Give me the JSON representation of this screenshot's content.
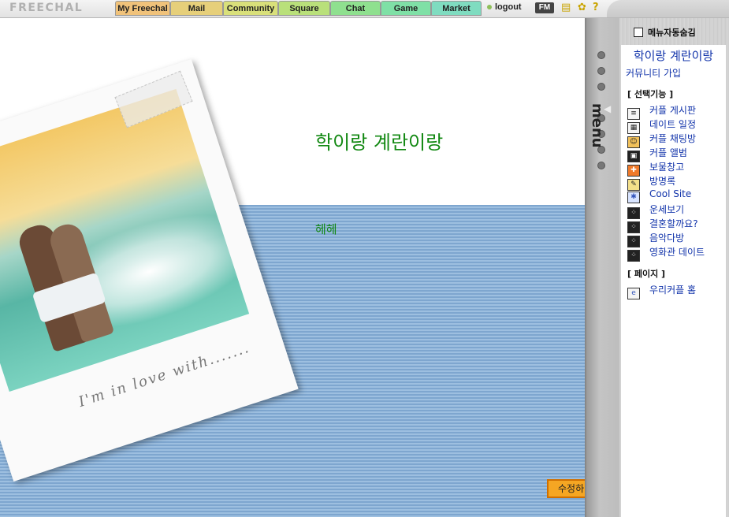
{
  "topbar": {
    "logo": "FREECHAL",
    "tabs": [
      {
        "label": "My Freechal",
        "color": "#f0c27a"
      },
      {
        "label": "Mail",
        "color": "#e6cf7a"
      },
      {
        "label": "Community",
        "color": "#d9e07a"
      },
      {
        "label": "Square",
        "color": "#b9e07a"
      },
      {
        "label": "Chat",
        "color": "#8fe08f"
      },
      {
        "label": "Game",
        "color": "#7fe0a6"
      },
      {
        "label": "Market",
        "color": "#7fdcc0"
      }
    ],
    "logout": "logout",
    "fm": "FM"
  },
  "main": {
    "title": "학이랑 계란이랑",
    "subtitle": "헤헤",
    "caption": "I'm in love with.......",
    "edit_button": "수정하"
  },
  "panel": {
    "auto_hide": "메뉴자동숨김",
    "menu_label": "menu",
    "community_title": "학이랑 계란이랑",
    "join": "커뮤니티 가입",
    "section_features": "[ 선택기능 ]",
    "features": [
      {
        "label": "커플 게시판",
        "icon": "board-icon"
      },
      {
        "label": "데이트 일정",
        "icon": "schedule-icon"
      },
      {
        "label": "커플 채팅방",
        "icon": "chat-icon"
      },
      {
        "label": "커플 앨범",
        "icon": "album-icon"
      },
      {
        "label": "보물창고",
        "icon": "treasure-icon"
      },
      {
        "label": "방명록",
        "icon": "guestbook-icon"
      },
      {
        "label": "Cool Site",
        "icon": "coolsite-icon"
      },
      {
        "label": "운세보기",
        "icon": "fortune-icon"
      },
      {
        "label": "결혼할까요?",
        "icon": "wedding-icon"
      },
      {
        "label": "음악다방",
        "icon": "music-icon"
      },
      {
        "label": "영화관 데이트",
        "icon": "movie-icon"
      }
    ],
    "section_pages": "[ 페이지 ]",
    "pages": [
      {
        "label": "우리커플 홈",
        "icon": "home-page-icon"
      }
    ]
  }
}
